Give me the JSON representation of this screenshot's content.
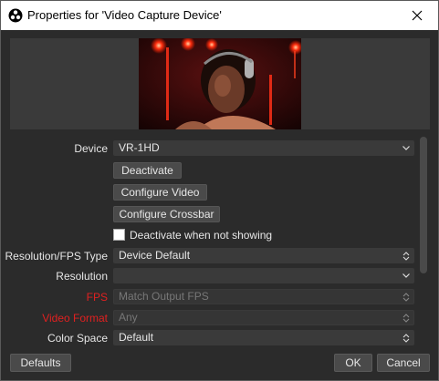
{
  "window": {
    "title": "Properties for 'Video Capture Device'"
  },
  "form": {
    "device": {
      "label": "Device",
      "value": "VR-1HD"
    },
    "deactivate_button": "Deactivate",
    "configure_video_button": "Configure Video",
    "configure_crossbar_button": "Configure Crossbar",
    "deactivate_when_not_showing": {
      "label": "Deactivate when not showing",
      "checked": false
    },
    "resolution_fps_type": {
      "label": "Resolution/FPS Type",
      "value": "Device Default"
    },
    "resolution": {
      "label": "Resolution",
      "value": ""
    },
    "fps": {
      "label": "FPS",
      "value": "Match Output FPS",
      "label_color": "#e02020"
    },
    "video_format": {
      "label": "Video Format",
      "value": "Any",
      "label_color": "#e02020"
    },
    "color_space": {
      "label": "Color Space",
      "value": "Default"
    }
  },
  "footer": {
    "defaults_button": "Defaults",
    "ok_button": "OK",
    "cancel_button": "Cancel"
  },
  "icons": {
    "app": "obs-logo-icon",
    "close": "close-icon",
    "dropdown": "chevron-updown-icon",
    "dropdown_down": "chevron-down-icon"
  }
}
